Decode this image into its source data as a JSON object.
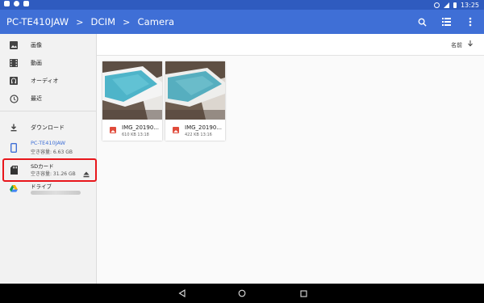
{
  "status_bar": {
    "time": "13:25"
  },
  "toolbar": {
    "breadcrumbs": [
      "PC-TE410JAW",
      "DCIM",
      "Camera"
    ],
    "separator": ">",
    "actions": [
      "search-icon",
      "list-view-icon",
      "more-vert-icon"
    ]
  },
  "drawer": {
    "items": [
      {
        "label": "画像",
        "icon": "image-icon"
      },
      {
        "label": "動画",
        "icon": "video-icon"
      },
      {
        "label": "オーディオ",
        "icon": "audio-icon"
      },
      {
        "label": "最近",
        "icon": "clock-icon"
      },
      {
        "label": "ダウンロード",
        "icon": "download-icon"
      },
      {
        "label": "PC-TE410JAW",
        "sub": "空き容量: 6.63 GB",
        "icon": "tablet-icon",
        "selected": true
      },
      {
        "label": "SDカード",
        "sub": "空き容量: 31.26 GB",
        "icon": "sd-card-icon",
        "eject": "eject-icon",
        "highlighted": true
      },
      {
        "label": "ドライブ",
        "icon": "drive-icon"
      }
    ]
  },
  "sort": {
    "label": "名前",
    "direction_icon": "arrow-down-icon"
  },
  "files": [
    {
      "name": "IMG_20190...",
      "meta": "610 KB 13:18"
    },
    {
      "name": "IMG_20190...",
      "meta": "422 KB 13:16"
    }
  ],
  "colors": {
    "accent": "#3f6fd6",
    "status_bar": "#2f5bbf",
    "selected_text": "#3f6fd6",
    "highlight": "#e8161b",
    "file_icon": "#e04b3b"
  }
}
